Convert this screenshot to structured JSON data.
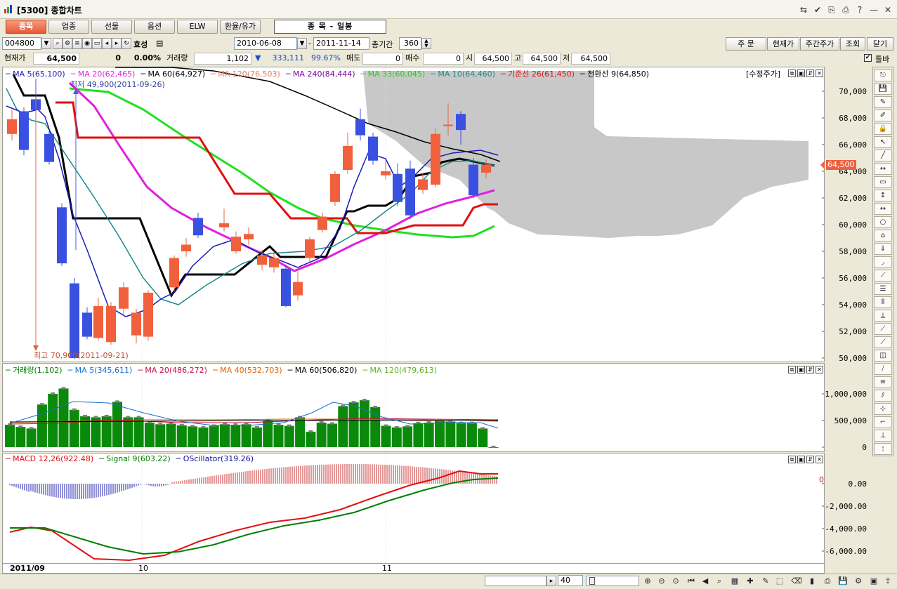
{
  "window": {
    "title": "[5300] 종합차트",
    "controls": [
      "⇆",
      "✔",
      "⎘",
      "⎙",
      "?",
      "—",
      "✕"
    ]
  },
  "tabs": [
    {
      "label": "종목",
      "active": true
    },
    {
      "label": "업종",
      "active": false
    },
    {
      "label": "선물",
      "active": false
    },
    {
      "label": "옵션",
      "active": false
    },
    {
      "label": "ELW",
      "active": false
    },
    {
      "label": "환율/유가",
      "active": false
    }
  ],
  "chart_title": "종 목 - 일봉",
  "controls": {
    "code": "004800",
    "stock_name": "효성",
    "start_date": "2010-06-08",
    "end_date": "2011-11-14",
    "period_label": "총기간",
    "period_value": "360"
  },
  "order_buttons": [
    "주 문",
    "현재가",
    "주간주가",
    "조회",
    "닫기"
  ],
  "toolbar_checkbox_label": "툴바",
  "price_info": {
    "current_label": "현재가",
    "current_value": "64,500",
    "change": "0",
    "change_pct": "0.00%",
    "volume_label": "거래량",
    "volume_value": "1,102",
    "prev_volume": "333,111",
    "ratio": "99.67%",
    "sell_label": "매도",
    "sell_value": "0",
    "buy_label": "매수",
    "buy_value": "0",
    "open_label": "시",
    "open_value": "64,500",
    "high_label": "고",
    "high_value": "64,500",
    "low_label": "저",
    "low_value": "64,500"
  },
  "price_pane": {
    "legend": [
      {
        "text": "MA 5(65,100)",
        "color": "#1c1cb4"
      },
      {
        "text": "MA 20(62,465)",
        "color": "#e020e0"
      },
      {
        "text": "MA 60(64,927)",
        "color": "#000000"
      },
      {
        "text": "MA 120(76,503)",
        "color": "#e08060"
      },
      {
        "text": "MA 240(84,444)",
        "color": "#8000a0"
      },
      {
        "text": "MA 33(60,045)",
        "color": "#20d020"
      },
      {
        "text": "MA 10(64,460)",
        "color": "#1a8a8a"
      },
      {
        "text": "기준선 26(61,450)",
        "color": "#e01010"
      },
      {
        "text": "전환선 9(64,850)",
        "color": "#000000"
      }
    ],
    "adjusted_label": "[수정주가]",
    "low_note": "최저 49,900(2011-09-26)",
    "high_note": "최고 70,900(2011-09-21)",
    "current_price_tag": "64,500",
    "y_ticks": [
      "70,000",
      "68,000",
      "66,000",
      "64,000",
      "62,000",
      "60,000",
      "58,000",
      "56,000",
      "54,000",
      "52,000",
      "50,000"
    ]
  },
  "volume_pane": {
    "legend": [
      {
        "text": "거래량(1,102)",
        "color": "#008000"
      },
      {
        "text": "MA 5(345,611)",
        "color": "#1c6cd0"
      },
      {
        "text": "MA 20(486,272)",
        "color": "#c01040"
      },
      {
        "text": "MA 40(532,703)",
        "color": "#e06000"
      },
      {
        "text": "MA 60(506,820)",
        "color": "#000000"
      },
      {
        "text": "MA 120(479,613)",
        "color": "#60b020"
      }
    ],
    "y_ticks": [
      "1,000,000",
      "500,000",
      "0"
    ]
  },
  "macd_pane": {
    "legend": [
      {
        "text": "MACD 12,26(922.48)",
        "color": "#e01010"
      },
      {
        "text": "Signal 9(603.22)",
        "color": "#008000"
      },
      {
        "text": "OScillator(319.26)",
        "color": "#1010a0"
      }
    ],
    "y_ticks": [
      "0.00",
      "-2,000.00",
      "-4,000.00",
      "-6,000.00"
    ],
    "right_zero": "0"
  },
  "x_axis": {
    "labels": [
      "2011/09",
      "10",
      "11"
    ]
  },
  "bottom": {
    "zoom_value": "40"
  },
  "colors": {
    "up": "#f0603c",
    "down": "#3a50e0",
    "cloud": "#c8c8c8",
    "volume": "#0a8a0a"
  }
}
